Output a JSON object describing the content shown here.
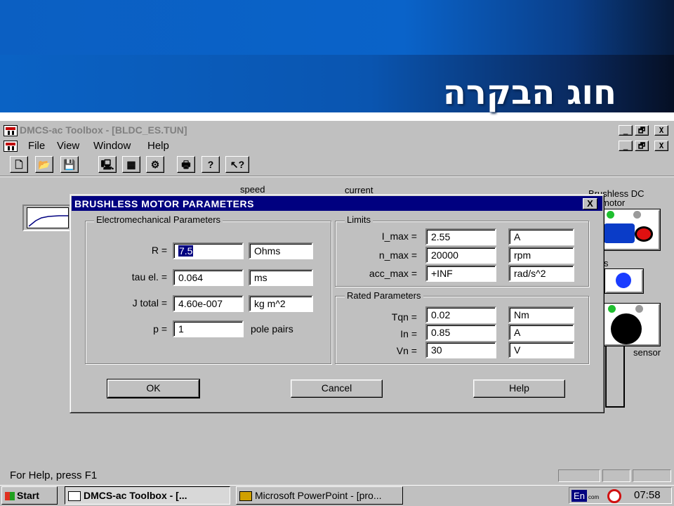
{
  "slide": {
    "title": "חוג הבקרה"
  },
  "app": {
    "title": "DMCS-ac Toolbox  - [BLDC_ES.TUN]",
    "menu": [
      "File",
      "View",
      "Window",
      "Help"
    ],
    "window_buttons": [
      "_",
      "🗗",
      "X"
    ],
    "toolbar_icons": [
      "new-file-icon",
      "open-folder-icon",
      "save-icon",
      "connect-icon",
      "monitor-icon",
      "tune-icon",
      "print-icon",
      "help-icon",
      "context-help-icon"
    ],
    "toolbar_glyphs": [
      "🗋",
      "📂",
      "💾",
      "🖳",
      "▦",
      "⚙",
      "🖶",
      "?",
      "↖?"
    ]
  },
  "workspace": {
    "labels": {
      "speed": "speed",
      "current": "current",
      "brushless_dc": "Brushless DC",
      "motor": "motor",
      "sensor": "sensor",
      "partial1": "...",
      "partial2": "s"
    }
  },
  "dialog": {
    "title": "BRUSHLESS MOTOR PARAMETERS",
    "close": "X",
    "electromechanical": {
      "label": "Electromechanical Parameters",
      "rows": [
        {
          "label": "R =",
          "value": "7.5",
          "unit": "Ohms"
        },
        {
          "label": "tau el. =",
          "value": "0.064",
          "unit": "ms"
        },
        {
          "label": "J total =",
          "value": "4.60e-007",
          "unit": "kg m^2"
        },
        {
          "label": "p =",
          "value": "1",
          "unit": "pole pairs"
        }
      ]
    },
    "limits": {
      "label": "Limits",
      "rows": [
        {
          "label": "I_max =",
          "value": "2.55",
          "unit": "A"
        },
        {
          "label": "n_max =",
          "value": "20000",
          "unit": "rpm"
        },
        {
          "label": "acc_max =",
          "value": "+INF",
          "unit": "rad/s^2"
        }
      ]
    },
    "rated": {
      "label": "Rated Parameters",
      "rows": [
        {
          "label": "Tqn =",
          "value": "0.02",
          "unit": "Nm"
        },
        {
          "label": "In =",
          "value": "0.85",
          "unit": "A"
        },
        {
          "label": "Vn =",
          "value": "30",
          "unit": "V"
        }
      ]
    },
    "buttons": {
      "ok": "OK",
      "cancel": "Cancel",
      "help": "Help"
    }
  },
  "status": {
    "text": "For Help, press F1"
  },
  "taskbar": {
    "start": "Start",
    "tasks": [
      "DMCS-ac Toolbox  - [...",
      "Microsoft PowerPoint - [pro..."
    ],
    "tray_lang": "En",
    "tray_small": "com",
    "clock": "07:58"
  }
}
